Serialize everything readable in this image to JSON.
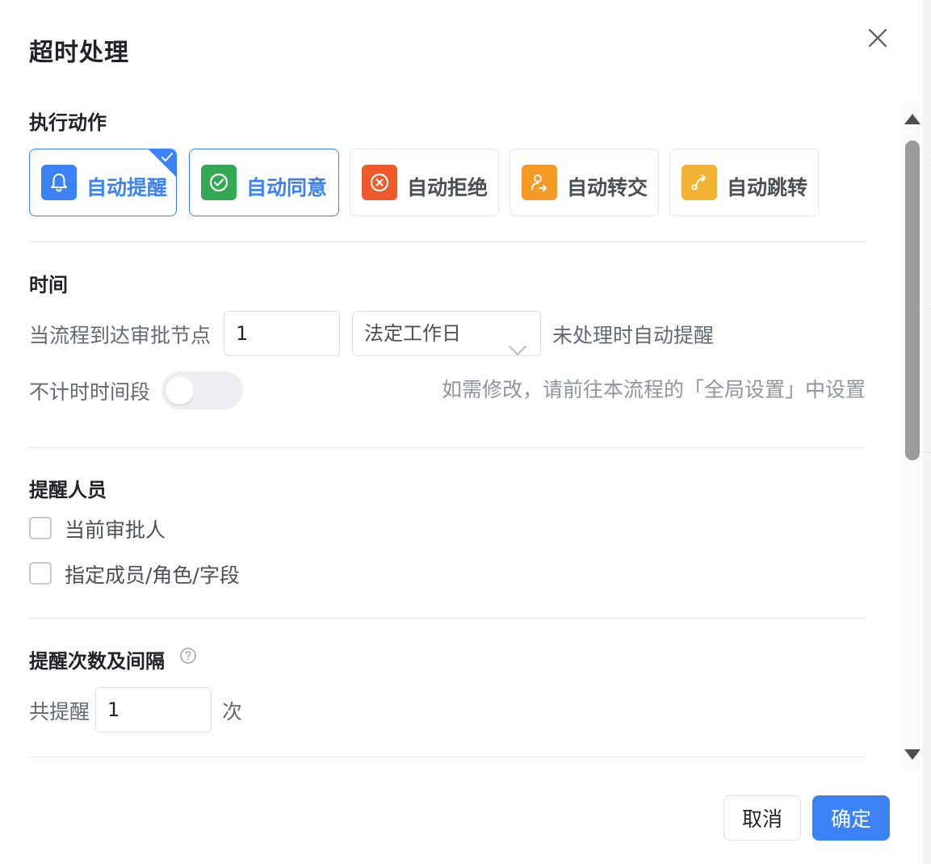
{
  "dialog": {
    "title": "超时处理"
  },
  "action_section": {
    "title": "执行动作",
    "options": [
      {
        "label": "自动提醒",
        "icon": "bell-icon",
        "color": "#3b82f6",
        "selected": true
      },
      {
        "label": "自动同意",
        "icon": "check-circle-icon",
        "color": "#34a853",
        "selected": true
      },
      {
        "label": "自动拒绝",
        "icon": "x-circle-icon",
        "color": "#f05a2a",
        "selected": false
      },
      {
        "label": "自动转交",
        "icon": "user-transfer-icon",
        "color": "#f59a23",
        "selected": false
      },
      {
        "label": "自动跳转",
        "icon": "redirect-arrow-icon",
        "color": "#f2b233",
        "selected": false
      }
    ]
  },
  "time_section": {
    "title": "时间",
    "prefix": "当流程到达审批节点",
    "amount": "1",
    "unit": "法定工作日",
    "suffix": "未处理时自动提醒",
    "exclude_label": "不计时时间段",
    "exclude_enabled": false,
    "exclude_hint": "如需修改，请前往本流程的「全局设置」中设置"
  },
  "remind_people": {
    "title": "提醒人员",
    "options": [
      {
        "label": "当前审批人",
        "checked": false
      },
      {
        "label": "指定成员/角色/字段",
        "checked": false
      }
    ]
  },
  "remind_count": {
    "title": "提醒次数及间隔",
    "prefix": "共提醒",
    "count": "1",
    "suffix": "次"
  },
  "footer": {
    "cancel": "取消",
    "confirm": "确定"
  },
  "colors": {
    "primary": "#3b82f6"
  }
}
